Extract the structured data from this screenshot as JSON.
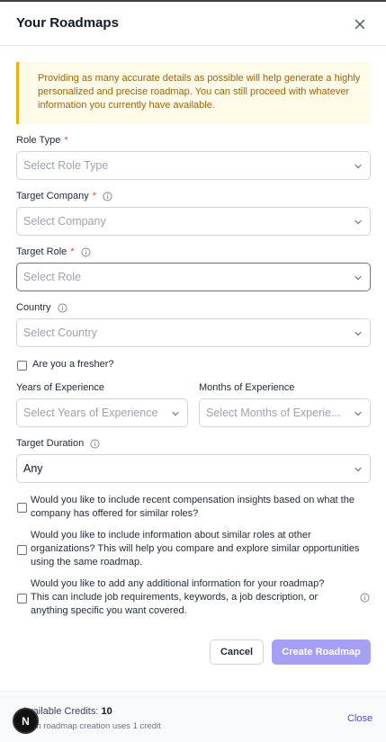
{
  "header": {
    "title": "Your Roadmaps"
  },
  "notice": {
    "text": "Providing as many accurate details as possible will help generate a highly personalized and precise roadmap. You can still proceed with whatever information you currently have available."
  },
  "fields": {
    "role_type": {
      "label": "Role Type",
      "placeholder": "Select Role Type"
    },
    "target_company": {
      "label": "Target Company",
      "placeholder": "Select Company"
    },
    "target_role": {
      "label": "Target Role",
      "placeholder": "Select Role"
    },
    "country": {
      "label": "Country",
      "placeholder": "Select Country"
    },
    "fresher": {
      "label": "Are you a fresher?"
    },
    "years_exp": {
      "label": "Years of Experience",
      "placeholder": "Select Years of Experience"
    },
    "months_exp": {
      "label": "Months of Experience",
      "placeholder": "Select Months of Experie..."
    },
    "target_duration": {
      "label": "Target Duration",
      "value": "Any"
    }
  },
  "required_marker": "*",
  "options": {
    "compensation": "Would you like to include recent compensation insights based on what the company has offered for similar roles?",
    "similar_roles": "Would you like to include information about similar roles at other organizations? This will help you compare and explore similar opportunities using the same roadmap.",
    "additional_info": "Would you like to add any additional information for your roadmap? This can include job requirements, keywords, a job description, or anything specific you want covered."
  },
  "actions": {
    "cancel": "Cancel",
    "create": "Create Roadmap"
  },
  "footer": {
    "credits_label": "Available Credits:",
    "credits_value": "10",
    "credits_note": "Each roadmap creation uses 1 credit",
    "close": "Close"
  },
  "badge": {
    "letter": "N"
  },
  "colors": {
    "accent": "#a5a0f5",
    "link": "#4f46e5",
    "required": "#ef4444",
    "notice_bg": "#fefce8",
    "notice_border": "#eab308"
  }
}
